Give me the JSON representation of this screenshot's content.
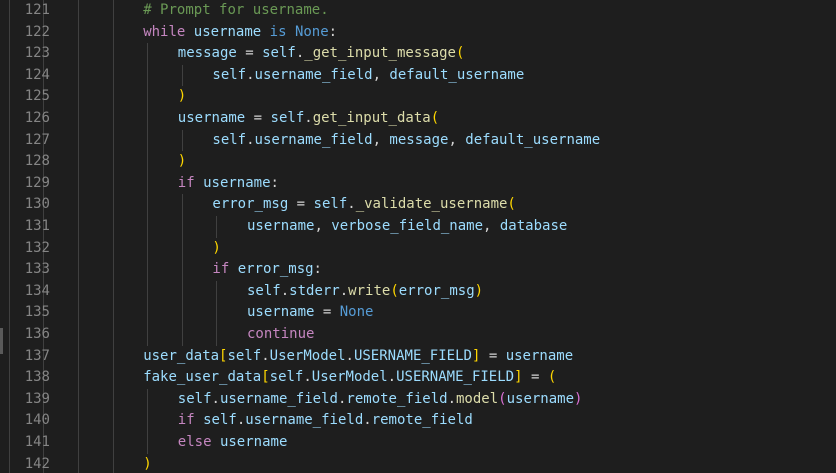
{
  "editor": {
    "colors": {
      "background": "#1e1e1e",
      "line_number": "#858585",
      "keyword": "#c586c0",
      "variable": "#9cdcfe",
      "function": "#dcdcaa",
      "constant": "#569cd6",
      "comment": "#6a9955",
      "bracket_level_1": "#ffd700",
      "bracket_level_2": "#da70d6",
      "bracket_level_3": "#179fff"
    },
    "lines": [
      {
        "num": "121",
        "indent": 4,
        "tokens": [
          [
            "comment",
            "# Prompt for username."
          ]
        ]
      },
      {
        "num": "122",
        "indent": 4,
        "tokens": [
          [
            "kw",
            "while"
          ],
          [
            "op",
            " "
          ],
          [
            "var",
            "username"
          ],
          [
            "op",
            " "
          ],
          [
            "const",
            "is"
          ],
          [
            "op",
            " "
          ],
          [
            "const",
            "None"
          ],
          [
            "op",
            ":"
          ]
        ]
      },
      {
        "num": "123",
        "indent": 5,
        "tokens": [
          [
            "var",
            "message"
          ],
          [
            "op",
            " = "
          ],
          [
            "var",
            "self"
          ],
          [
            "op",
            "."
          ],
          [
            "fn",
            "_get_input_message"
          ],
          [
            "p1",
            "("
          ]
        ]
      },
      {
        "num": "124",
        "indent": 6,
        "tokens": [
          [
            "var",
            "self"
          ],
          [
            "op",
            "."
          ],
          [
            "var",
            "username_field"
          ],
          [
            "op",
            ", "
          ],
          [
            "var",
            "default_username"
          ]
        ]
      },
      {
        "num": "125",
        "indent": 5,
        "tokens": [
          [
            "p1",
            ")"
          ]
        ]
      },
      {
        "num": "126",
        "indent": 5,
        "tokens": [
          [
            "var",
            "username"
          ],
          [
            "op",
            " = "
          ],
          [
            "var",
            "self"
          ],
          [
            "op",
            "."
          ],
          [
            "fn",
            "get_input_data"
          ],
          [
            "p1",
            "("
          ]
        ]
      },
      {
        "num": "127",
        "indent": 6,
        "tokens": [
          [
            "var",
            "self"
          ],
          [
            "op",
            "."
          ],
          [
            "var",
            "username_field"
          ],
          [
            "op",
            ", "
          ],
          [
            "var",
            "message"
          ],
          [
            "op",
            ", "
          ],
          [
            "var",
            "default_username"
          ]
        ]
      },
      {
        "num": "128",
        "indent": 5,
        "tokens": [
          [
            "p1",
            ")"
          ]
        ]
      },
      {
        "num": "129",
        "indent": 5,
        "tokens": [
          [
            "kw",
            "if"
          ],
          [
            "op",
            " "
          ],
          [
            "var",
            "username"
          ],
          [
            "op",
            ":"
          ]
        ]
      },
      {
        "num": "130",
        "indent": 6,
        "tokens": [
          [
            "var",
            "error_msg"
          ],
          [
            "op",
            " = "
          ],
          [
            "var",
            "self"
          ],
          [
            "op",
            "."
          ],
          [
            "fn",
            "_validate_username"
          ],
          [
            "p1",
            "("
          ]
        ]
      },
      {
        "num": "131",
        "indent": 7,
        "tokens": [
          [
            "var",
            "username"
          ],
          [
            "op",
            ", "
          ],
          [
            "var",
            "verbose_field_name"
          ],
          [
            "op",
            ", "
          ],
          [
            "var",
            "database"
          ]
        ]
      },
      {
        "num": "132",
        "indent": 6,
        "tokens": [
          [
            "p1",
            ")"
          ]
        ]
      },
      {
        "num": "133",
        "indent": 6,
        "tokens": [
          [
            "kw",
            "if"
          ],
          [
            "op",
            " "
          ],
          [
            "var",
            "error_msg"
          ],
          [
            "op",
            ":"
          ]
        ]
      },
      {
        "num": "134",
        "indent": 7,
        "tokens": [
          [
            "var",
            "self"
          ],
          [
            "op",
            "."
          ],
          [
            "var",
            "stderr"
          ],
          [
            "op",
            "."
          ],
          [
            "fn",
            "write"
          ],
          [
            "p1",
            "("
          ],
          [
            "var",
            "error_msg"
          ],
          [
            "p1",
            ")"
          ]
        ]
      },
      {
        "num": "135",
        "indent": 7,
        "tokens": [
          [
            "var",
            "username"
          ],
          [
            "op",
            " = "
          ],
          [
            "const",
            "None"
          ]
        ]
      },
      {
        "num": "136",
        "indent": 7,
        "tokens": [
          [
            "kw",
            "continue"
          ]
        ]
      },
      {
        "num": "137",
        "indent": 4,
        "tokens": [
          [
            "var",
            "user_data"
          ],
          [
            "p1",
            "["
          ],
          [
            "var",
            "self"
          ],
          [
            "op",
            "."
          ],
          [
            "var",
            "UserModel"
          ],
          [
            "op",
            "."
          ],
          [
            "var",
            "USERNAME_FIELD"
          ],
          [
            "p1",
            "]"
          ],
          [
            "op",
            " = "
          ],
          [
            "var",
            "username"
          ]
        ]
      },
      {
        "num": "138",
        "indent": 4,
        "tokens": [
          [
            "var",
            "fake_user_data"
          ],
          [
            "p1",
            "["
          ],
          [
            "var",
            "self"
          ],
          [
            "op",
            "."
          ],
          [
            "var",
            "UserModel"
          ],
          [
            "op",
            "."
          ],
          [
            "var",
            "USERNAME_FIELD"
          ],
          [
            "p1",
            "]"
          ],
          [
            "op",
            " = "
          ],
          [
            "p1",
            "("
          ]
        ]
      },
      {
        "num": "139",
        "indent": 5,
        "tokens": [
          [
            "var",
            "self"
          ],
          [
            "op",
            "."
          ],
          [
            "var",
            "username_field"
          ],
          [
            "op",
            "."
          ],
          [
            "var",
            "remote_field"
          ],
          [
            "op",
            "."
          ],
          [
            "fn",
            "model"
          ],
          [
            "p2",
            "("
          ],
          [
            "var",
            "username"
          ],
          [
            "p2",
            ")"
          ]
        ]
      },
      {
        "num": "140",
        "indent": 5,
        "tokens": [
          [
            "kw",
            "if"
          ],
          [
            "op",
            " "
          ],
          [
            "var",
            "self"
          ],
          [
            "op",
            "."
          ],
          [
            "var",
            "username_field"
          ],
          [
            "op",
            "."
          ],
          [
            "var",
            "remote_field"
          ]
        ]
      },
      {
        "num": "141",
        "indent": 5,
        "tokens": [
          [
            "kw",
            "else"
          ],
          [
            "op",
            " "
          ],
          [
            "var",
            "username"
          ]
        ]
      },
      {
        "num": "142",
        "indent": 4,
        "tokens": [
          [
            "p1",
            ")"
          ]
        ]
      }
    ]
  }
}
